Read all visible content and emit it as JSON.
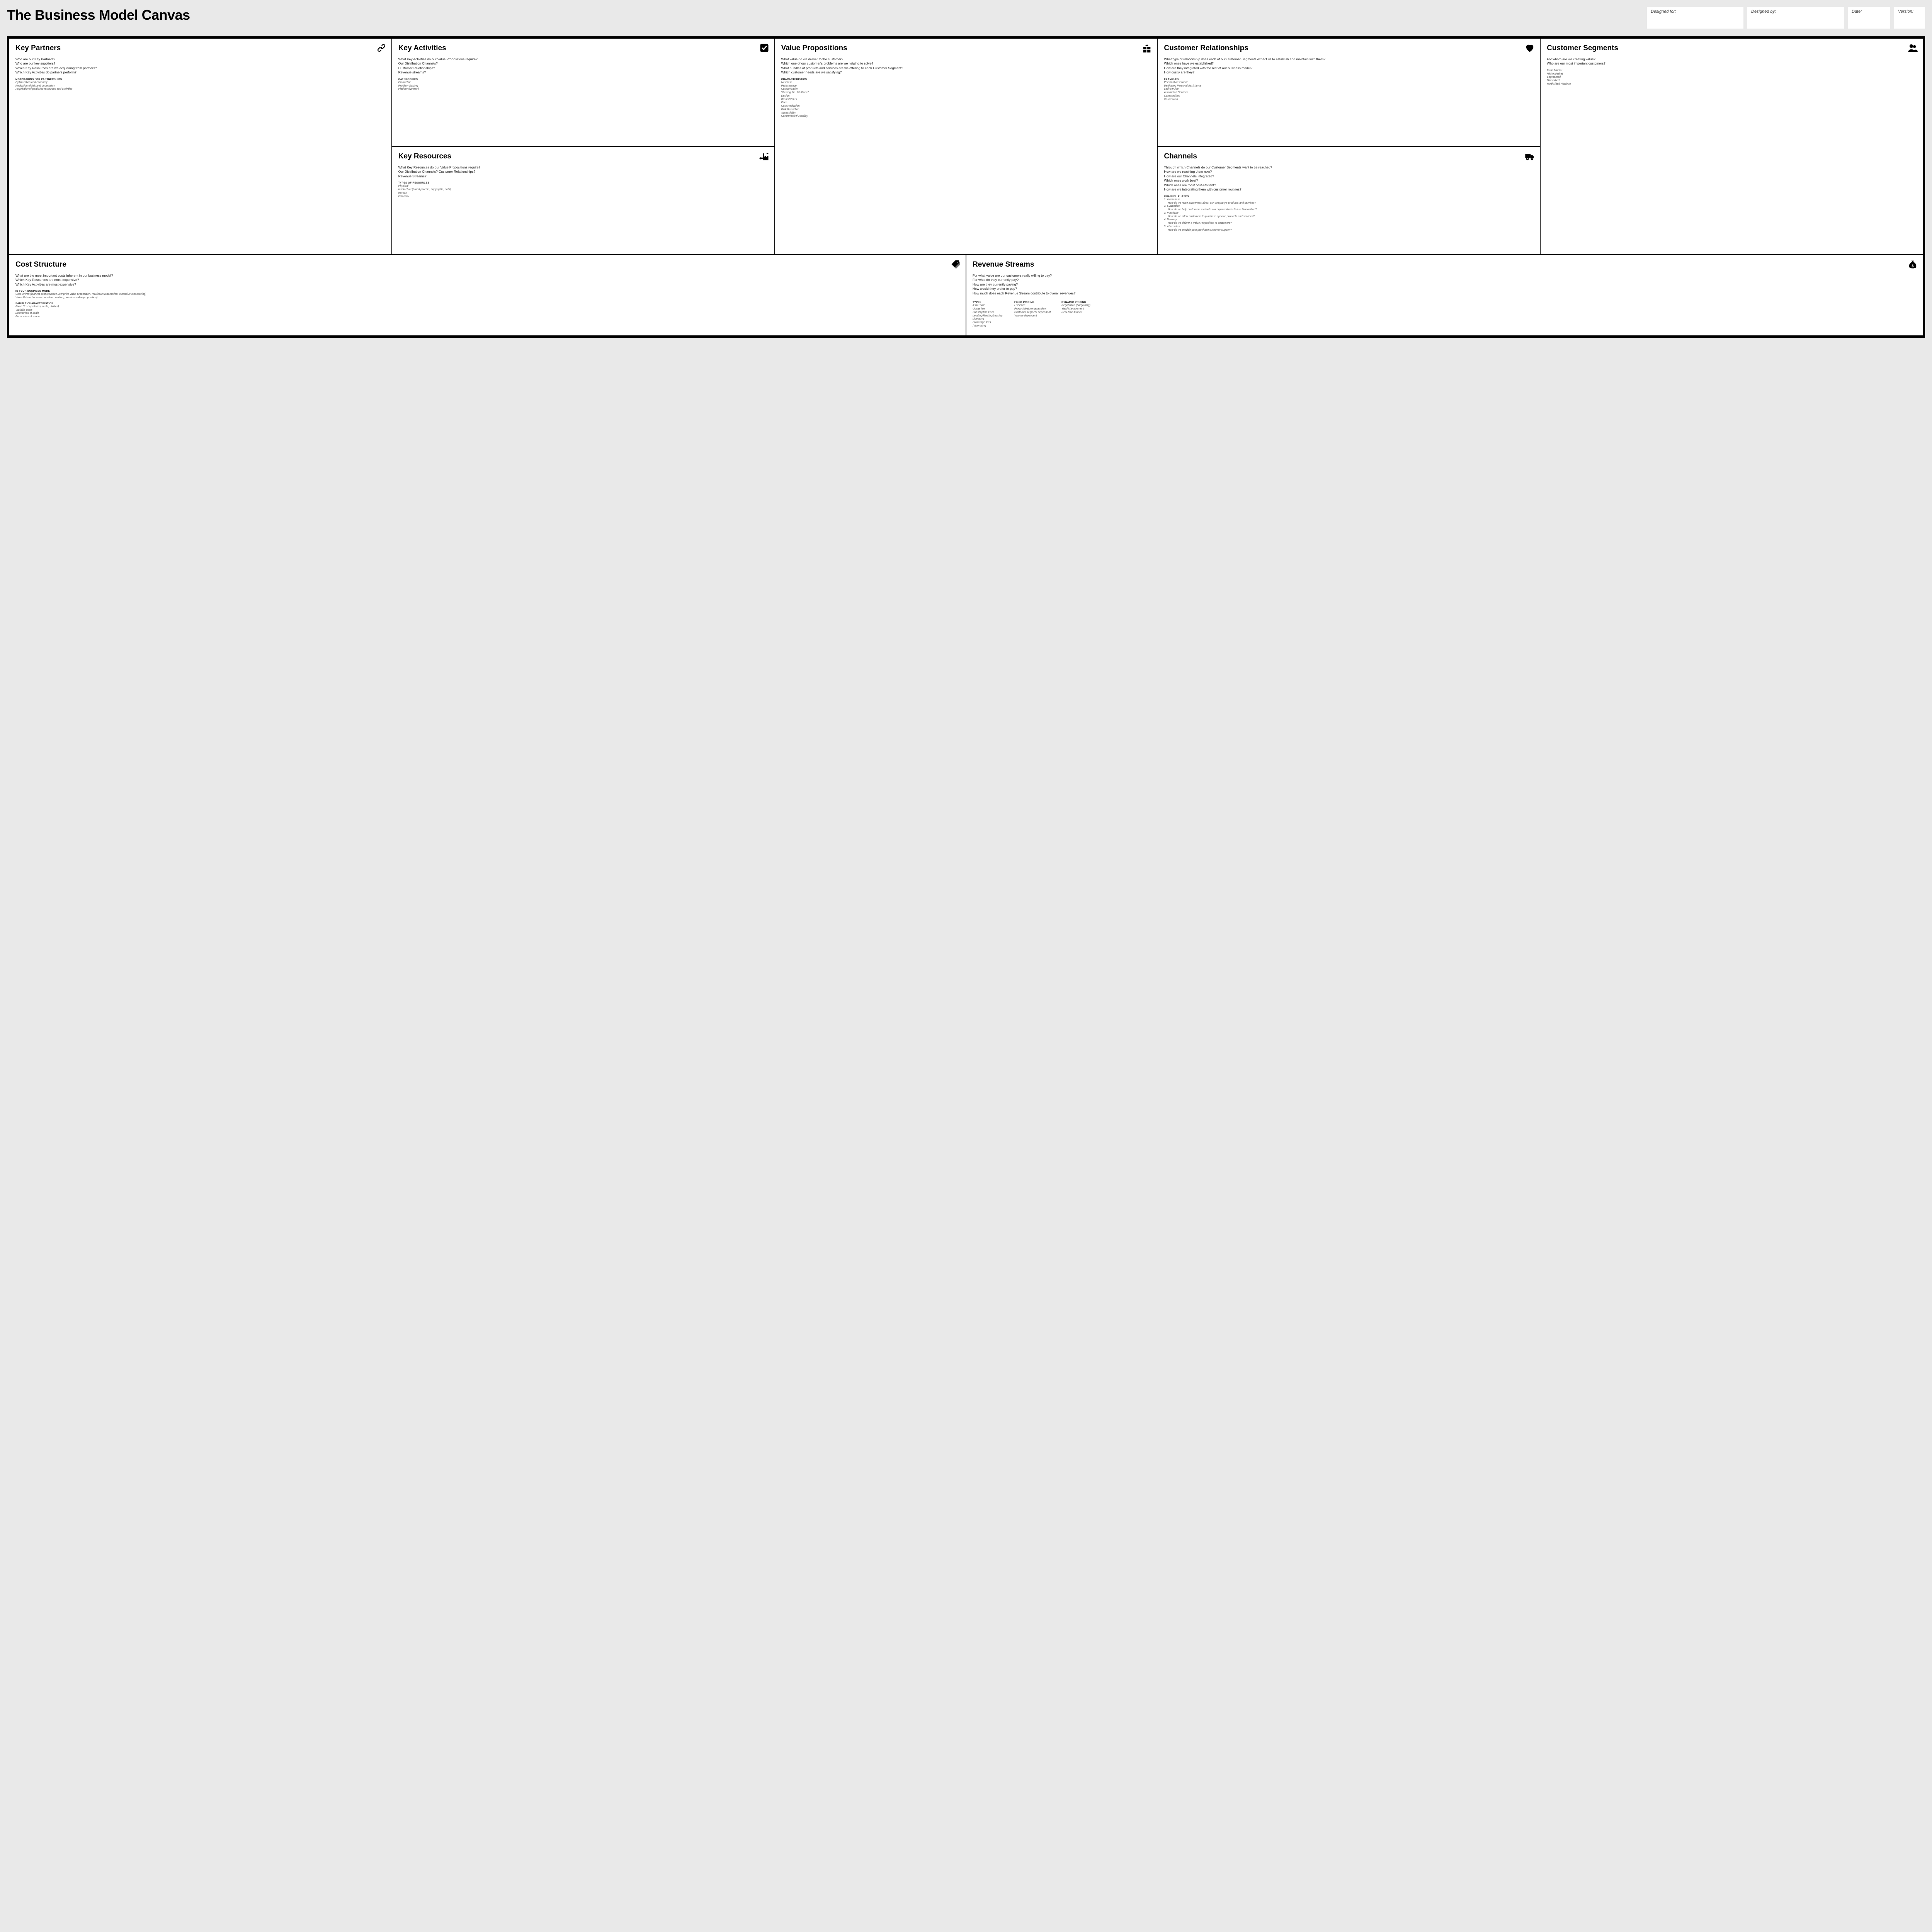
{
  "header": {
    "title": "The Business Model Canvas",
    "meta": {
      "designed_for_label": "Designed for:",
      "designed_by_label": "Designed by:",
      "date_label": "Date:",
      "version_label": "Version:"
    }
  },
  "cells": {
    "key_partners": {
      "title": "Key Partners",
      "questions": [
        "Who are our Key Partners?",
        "Who are our key suppliers?",
        "Which Key Resources are we acquairing from partners?",
        "Which Key Activities do partners perform?"
      ],
      "subhead": "motivations for partnerships",
      "examples": [
        "Optimization and economy",
        "Reduction of risk and uncertainty",
        "Acquisition of particular resources and activities"
      ]
    },
    "key_activities": {
      "title": "Key Activities",
      "questions": [
        "What Key Activities do our Value Propositions require?",
        "Our Distribution Channels?",
        "Customer Relationships?",
        "Revenue streams?"
      ],
      "subhead": "catergories",
      "examples": [
        "Production",
        "Problem Solving",
        "Platform/Network"
      ]
    },
    "key_resources": {
      "title": "Key Resources",
      "questions": [
        "What Key Resources do our Value Propositions require?",
        "Our Distribution Channels? Customer Relationships?",
        "Revenue Streams?"
      ],
      "subhead": "types of resources",
      "examples": [
        "Physical",
        "Intellectual (brand patents, copyrights, data)",
        "Human",
        "Financial"
      ]
    },
    "value_propositions": {
      "title": "Value Propositions",
      "questions": [
        "What value do we deliver to the customer?",
        "Which one of our customer's problems are we helping to solve?",
        "What bundles of products and services are we offering to each Customer Segment?",
        "Which customer needs are we satisfying?"
      ],
      "subhead": "characteristics",
      "examples": [
        "Newness",
        "Performance",
        "Customization",
        "\"Getting the Job Done\"",
        "Design",
        "Brand/Status",
        "Price",
        "Cost Reduction",
        "Risk Reduction",
        "Accessibility",
        "Convenience/Usability"
      ]
    },
    "customer_relationships": {
      "title": "Customer Relationships",
      "questions": [
        "What type of relationship does each of our Customer Segments expect us to establish and maintain with them?",
        "Which ones have we established?",
        "How are they integrated with the rest of our business model?",
        "How costly are they?"
      ],
      "subhead": "examples",
      "examples": [
        "Personal assistance",
        "Dedicated Personal Assistance",
        "Self-Service",
        "Automated Services",
        "Communities",
        "Co-creation"
      ]
    },
    "channels": {
      "title": "Channels",
      "questions": [
        "Through which Channels do our Customer Segments want to be reached?",
        "How are we reaching them now?",
        "How are our Channels integrated?",
        "Which ones work best?",
        "Which ones are most cost-efficient?",
        "How are we integrating them with customer routines?"
      ],
      "subhead": "channel phases",
      "phases": [
        {
          "n": "1. Awareness",
          "q": "How do we raise awareness about our company's products and services?"
        },
        {
          "n": "2. Evaluation",
          "q": "How do we help customers evaluate our organization's Value Proposition?"
        },
        {
          "n": "3. Purchase",
          "q": "How do we allow customers to purchase specific products and services?"
        },
        {
          "n": "4. Delivery",
          "q": "How do we deliver a Value Proposition to customers?"
        },
        {
          "n": "5. After sales",
          "q": "How do we provide post-purchase customer support?"
        }
      ]
    },
    "customer_segments": {
      "title": "Customer Segments",
      "questions": [
        "For whom are we creating value?",
        "Who are our most important customers?"
      ],
      "examples": [
        "Mass Market",
        "Niche Market",
        "Segmented",
        "Diversified",
        "Multi-sided Platform"
      ]
    },
    "cost_structure": {
      "title": "Cost Structure",
      "questions": [
        "What are the most important costs inherent in our business model?",
        "Which Key Resources are most expensive?",
        "Which Key Activities are most expensive?"
      ],
      "subhead1": "is your business more",
      "examples1": [
        "Cost Driven (leanest cost structure, low price value proposition, maximum automation, extensive outsourcing)",
        "Value Driven (focused on value creation, premium value proposition)"
      ],
      "subhead2": "sample characteristics",
      "examples2": [
        "Fixed Costs (salaries, rents, utilities)",
        "Variable costs",
        "Economies of scale",
        "Economies of scope"
      ]
    },
    "revenue_streams": {
      "title": "Revenue Streams",
      "questions": [
        "For what value are our customers really willing to pay?",
        "For what do they currently pay?",
        "How are they currently paying?",
        "How would they prefer to pay?",
        "How much does each Revenue Stream contribute to overall revenues?"
      ],
      "col1_head": "types",
      "col1": [
        "Asset sale",
        "Usage fee",
        "Subscription Fees",
        "Lending/Renting/Leasing",
        "Licensing",
        "Brokerage fees",
        "Advertising"
      ],
      "col2_head": "fixed pricing",
      "col2": [
        "List Price",
        "Product feature dependent",
        "Customer segment dependent",
        "Volume dependent"
      ],
      "col3_head": "dynamic pricing",
      "col3": [
        "Negotiation (bargaining)",
        "Yield Management",
        "Real-time-Market"
      ]
    }
  }
}
